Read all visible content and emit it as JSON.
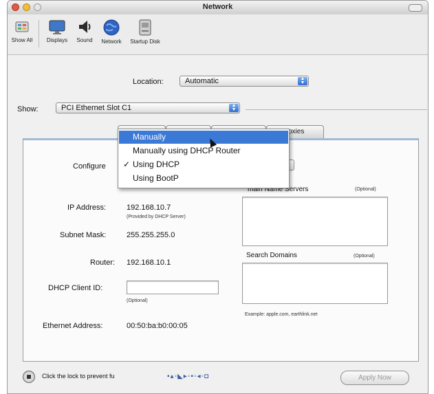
{
  "window": {
    "title": "Network"
  },
  "toolbar": {
    "items": [
      {
        "label": "Show All",
        "icon": "show-all-icon"
      },
      {
        "label": "Displays",
        "icon": "displays-icon"
      },
      {
        "label": "Sound",
        "icon": "sound-icon"
      },
      {
        "label": "Network",
        "icon": "network-icon"
      },
      {
        "label": "Startup Disk",
        "icon": "startup-disk-icon"
      }
    ]
  },
  "location": {
    "label": "Location:",
    "value": "Automatic"
  },
  "show": {
    "label": "Show:",
    "value": "PCI Ethernet Slot C1"
  },
  "tabs": [
    {
      "label": ""
    },
    {
      "label": ""
    },
    {
      "label": ""
    },
    {
      "label": "roxies"
    }
  ],
  "configure": {
    "label": "Configure",
    "menu": [
      {
        "label": "Manually",
        "highlighted": true,
        "checked": false
      },
      {
        "label": "Manually using DHCP Router",
        "highlighted": false,
        "checked": false
      },
      {
        "label": "Using DHCP",
        "highlighted": false,
        "checked": true
      },
      {
        "label": "Using BootP",
        "highlighted": false,
        "checked": false
      }
    ]
  },
  "ip_address": {
    "label": "IP Address:",
    "value": "192.168.10.7",
    "note": "(Provided by DHCP Server)"
  },
  "subnet_mask": {
    "label": "Subnet Mask:",
    "value": "255.255.255.0"
  },
  "router": {
    "label": "Router:",
    "value": "192.168.10.1"
  },
  "dhcp_client_id": {
    "label": "DHCP Client ID:",
    "value": "",
    "note": "(Optional)"
  },
  "ethernet_address": {
    "label": "Ethernet Address:",
    "value": "00:50:ba:b0:00:05"
  },
  "dns": {
    "label": "Domain Name Servers",
    "note": "(Optional)",
    "label_visible": "main Name Servers"
  },
  "search_domains": {
    "label": "Search Domains",
    "note": "(Optional)",
    "example": "Example: apple.com, earthlink.net"
  },
  "lock": {
    "text": "Click the lock to prevent fu"
  },
  "apply": {
    "label": "Apply Now"
  },
  "colors": {
    "highlight": "#3a79d6",
    "accent": "#2e6cd0"
  }
}
